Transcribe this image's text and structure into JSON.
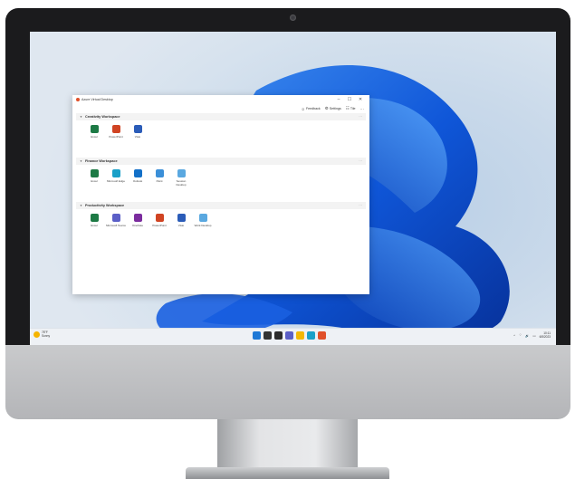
{
  "window": {
    "title": "Azure Virtual Desktop",
    "controls": {
      "minimize": "–",
      "maximize": "☐",
      "close": "✕"
    },
    "toolbar": [
      {
        "icon": "feedback-icon",
        "glyph": "☺",
        "label": "Feedback"
      },
      {
        "icon": "gear-icon",
        "glyph": "⚙",
        "label": "Settings"
      },
      {
        "icon": "tile-view-icon",
        "glyph": "☷",
        "label": "Tile"
      },
      {
        "icon": "more-icon",
        "glyph": "···",
        "label": ""
      }
    ]
  },
  "workspaces": [
    {
      "name": "Creativity Workspace",
      "apps": [
        {
          "label": "Excel",
          "color": "#1d7a45"
        },
        {
          "label": "PowerPoint",
          "color": "#d04423"
        },
        {
          "label": "Visio",
          "color": "#2b5cb8"
        }
      ]
    },
    {
      "name": "Finance Workspace",
      "apps": [
        {
          "label": "Excel",
          "color": "#1d7a45"
        },
        {
          "label": "Microsoft Edge",
          "color": "#1aa0c8"
        },
        {
          "label": "Outlook",
          "color": "#1370c8"
        },
        {
          "label": "Paint",
          "color": "#3b8fd8"
        },
        {
          "label": "Session Desktop",
          "color": "#5aa8e0"
        }
      ]
    },
    {
      "name": "Productivity Workspace",
      "apps": [
        {
          "label": "Excel",
          "color": "#1d7a45"
        },
        {
          "label": "Microsoft Teams",
          "color": "#5b5fc7"
        },
        {
          "label": "OneNote",
          "color": "#7b2c9e"
        },
        {
          "label": "PowerPoint",
          "color": "#d04423"
        },
        {
          "label": "Visio",
          "color": "#2b5cb8"
        },
        {
          "label": "Work Desktop",
          "color": "#5aa8e0"
        }
      ]
    }
  ],
  "taskbar": {
    "weather_temp": "78°F",
    "weather_desc": "Sunny",
    "pinned": [
      {
        "name": "start-icon",
        "color": "#1e78d6"
      },
      {
        "name": "search-icon",
        "color": "#333333"
      },
      {
        "name": "task-view-icon",
        "color": "#2c2c2c"
      },
      {
        "name": "chat-icon",
        "color": "#5b5fc7"
      },
      {
        "name": "file-explorer-icon",
        "color": "#f2b705"
      },
      {
        "name": "edge-icon",
        "color": "#1aa0c8"
      },
      {
        "name": "avd-app-icon",
        "color": "#e0502a"
      }
    ],
    "tray": {
      "chevron": "^",
      "network": "⌔",
      "volume": "🔊",
      "battery": "▭"
    },
    "time": "10:11",
    "date": "6/5/2023"
  }
}
